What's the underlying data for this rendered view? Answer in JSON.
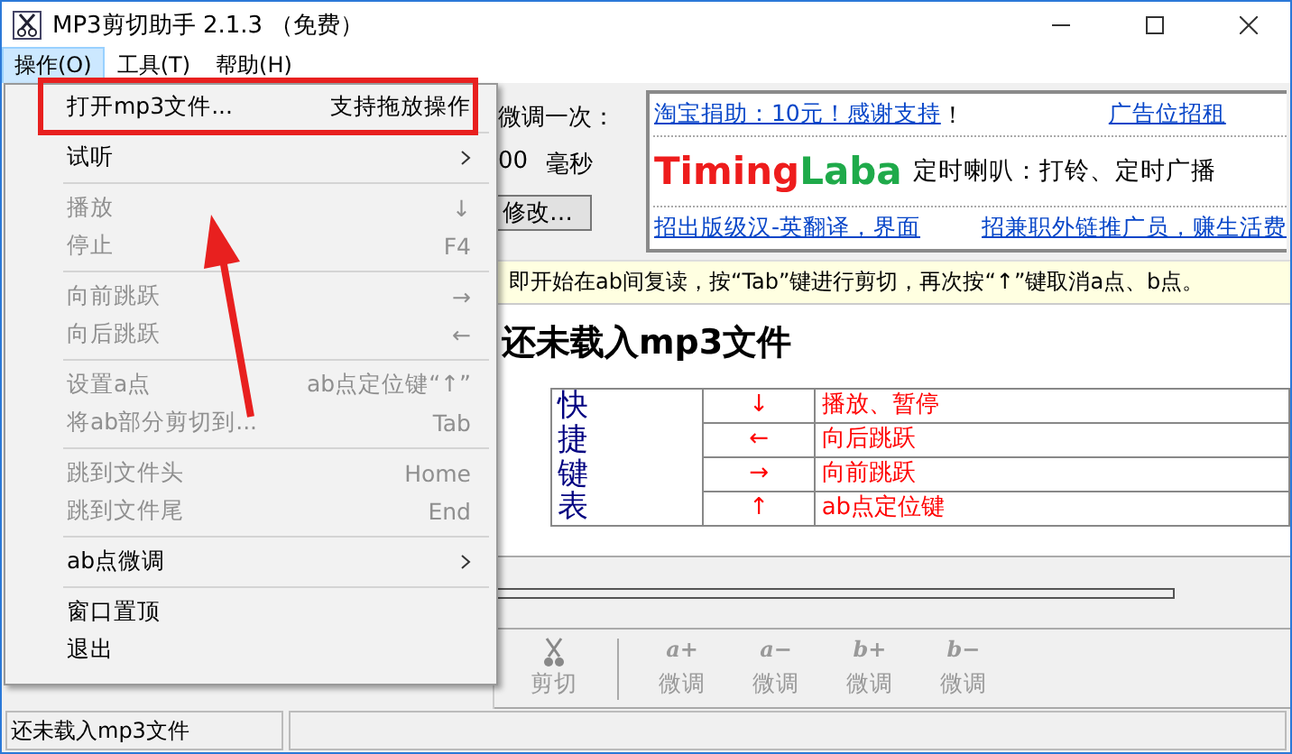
{
  "window": {
    "title": "MP3剪切助手 2.1.3 （免费）"
  },
  "menu_bar": [
    {
      "label": "操作(O)",
      "selected": true
    },
    {
      "label": "工具(T)",
      "selected": false
    },
    {
      "label": "帮助(H)",
      "selected": false
    }
  ],
  "dropdown": {
    "groups": [
      [
        {
          "label": "打开mp3文件...",
          "shortcut": "支持拖放操作",
          "disabled": false,
          "submenu": false
        }
      ],
      [
        {
          "label": "试听",
          "disabled": false,
          "submenu": true
        }
      ],
      [
        {
          "label": "播放",
          "shortcut": "↓",
          "disabled": true,
          "submenu": false
        },
        {
          "label": "停止",
          "shortcut": "F4",
          "disabled": true,
          "submenu": false
        }
      ],
      [
        {
          "label": "向前跳跃",
          "shortcut": "→",
          "disabled": true,
          "submenu": false
        },
        {
          "label": "向后跳跃",
          "shortcut": "←",
          "disabled": true,
          "submenu": false
        }
      ],
      [
        {
          "label": "设置a点",
          "shortcut": "ab点定位键“↑”",
          "disabled": true,
          "submenu": false
        },
        {
          "label": "将ab部分剪切到...",
          "shortcut": "Tab",
          "disabled": true,
          "submenu": false
        }
      ],
      [
        {
          "label": "跳到文件头",
          "shortcut": "Home",
          "disabled": true,
          "submenu": false
        },
        {
          "label": "跳到文件尾",
          "shortcut": "End",
          "disabled": true,
          "submenu": false
        }
      ],
      [
        {
          "label": "ab点微调",
          "disabled": false,
          "submenu": true
        }
      ],
      [
        {
          "label": "窗口置顶",
          "disabled": false,
          "submenu": false
        },
        {
          "label": "退出",
          "disabled": false,
          "submenu": false
        }
      ]
    ]
  },
  "adjust": {
    "label": "微调一次：",
    "value": "00",
    "unit": "毫秒",
    "button": "修改…"
  },
  "ads": {
    "links_top": [
      "淘宝捐助：10元！感谢支持",
      "广告位招租"
    ],
    "exclaim": "！",
    "logo": [
      {
        "text": "Timing",
        "color": "#ee1c1c"
      },
      {
        "text": "Laba",
        "color": "#1faa4a"
      }
    ],
    "slogan": "定时喇叭：打铃、定时广播",
    "links_bottom": [
      "招出版级汉-英翻译，界面",
      "招兼职外链推广员，赚生活费"
    ]
  },
  "hint": "即开始在ab间复读，按“Tab”键进行剪切，再次按“↑”键取消a点、b点。",
  "heading": "还未载入mp3文件",
  "shortcut_table": {
    "title": "快捷键表",
    "rows": [
      {
        "key": "↓",
        "action": "播放、暂停"
      },
      {
        "key": "←",
        "action": "向后跳跃"
      },
      {
        "key": "→",
        "action": "向前跳跃"
      },
      {
        "key": "↑",
        "action": "ab点定位键"
      }
    ]
  },
  "toolbar": [
    {
      "kind": "scissors",
      "label": "剪切",
      "disabled": true
    },
    {
      "kind": "separator"
    },
    {
      "kind": "glyph",
      "glyph": "a+",
      "label": "微调",
      "disabled": true
    },
    {
      "kind": "glyph",
      "glyph": "a−",
      "label": "微调",
      "disabled": true
    },
    {
      "kind": "glyph",
      "glyph": "b+",
      "label": "微调",
      "disabled": true
    },
    {
      "kind": "glyph",
      "glyph": "b−",
      "label": "微调",
      "disabled": true
    }
  ],
  "status_bar": {
    "text": "还未载入mp3文件"
  }
}
